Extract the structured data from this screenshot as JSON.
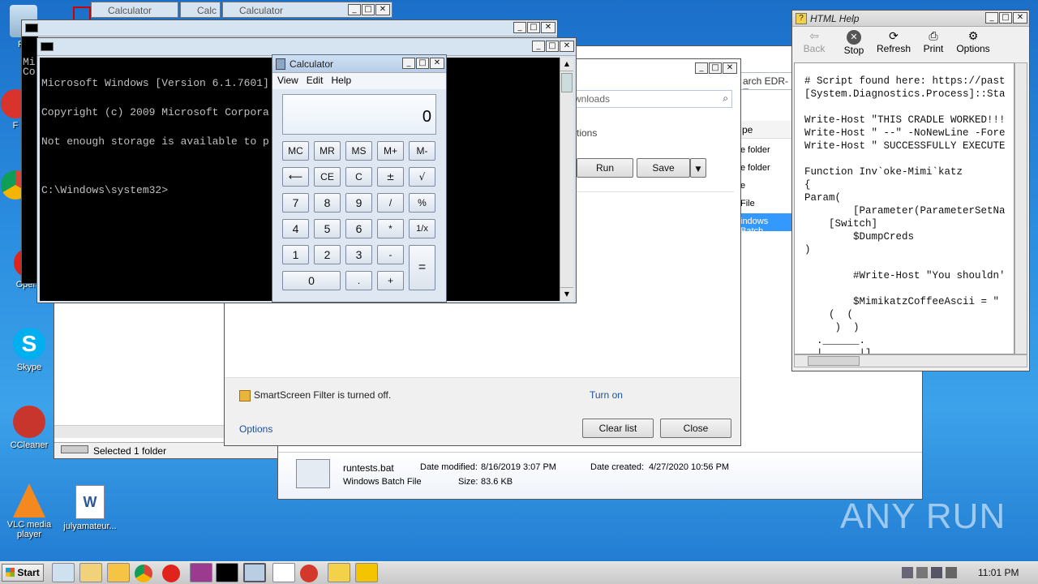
{
  "desktop": {
    "icons": [
      {
        "label": "Re"
      },
      {
        "label": "F"
      },
      {
        "label": "Opera"
      },
      {
        "label": "Skype"
      },
      {
        "label": "CCleaner"
      },
      {
        "label": "VLC media player"
      },
      {
        "label": "julyamateur..."
      }
    ]
  },
  "top_tabs": [
    {
      "label": "Calculator"
    },
    {
      "label": "Calc"
    },
    {
      "label": "Calculator"
    }
  ],
  "cmd": {
    "title_short": "Mi",
    "title_short2": "Co",
    "lines": [
      "Microsoft Windows [Version 6.1.7601]",
      "Copyright (c) 2009 Microsoft Corpora",
      "Not enough storage is available to p",
      "",
      "C:\\Windows\\system32>"
    ]
  },
  "calculator": {
    "title": "Calculator",
    "menu": [
      "View",
      "Edit",
      "Help"
    ],
    "display": "0",
    "buttons": {
      "mc": "MC",
      "mr": "MR",
      "ms": "MS",
      "mplus": "M+",
      "mminus": "M-",
      "back": "⟵",
      "ce": "CE",
      "c": "C",
      "pm": "±",
      "sqrt": "√",
      "n7": "7",
      "n8": "8",
      "n9": "9",
      "div": "/",
      "pct": "%",
      "n4": "4",
      "n5": "5",
      "n6": "6",
      "mul": "*",
      "inv": "1/x",
      "n1": "1",
      "n2": "2",
      "n3": "3",
      "sub": "-",
      "eq": "=",
      "n0": "0",
      "dot": ".",
      "add": "+"
    }
  },
  "downloads": {
    "search_placeholder": "wnloads",
    "section": "ctions",
    "run": "Run",
    "save": "Save",
    "smartscreen": "SmartScreen Filter is turned off.",
    "turn_on": "Turn on",
    "options": "Options",
    "clear_list": "Clear list",
    "close": "Close"
  },
  "explorer": {
    "search_text": "arch EDR-Tes",
    "col_type": "pe",
    "rows": [
      "e folder",
      "e folder",
      "e",
      "File",
      "indows Batch"
    ],
    "status": "Selected 1 folder",
    "details": {
      "filename": "runtests.bat",
      "filetype": "Windows Batch File",
      "modified_label": "Date modified:",
      "modified": "8/16/2019 3:07 PM",
      "created_label": "Date created:",
      "created": "4/27/2020 10:56 PM",
      "size_label": "Size:",
      "size": "83.6 KB"
    }
  },
  "html_help": {
    "title": "HTML Help",
    "toolbar": {
      "back": "Back",
      "stop": "Stop",
      "refresh": "Refresh",
      "print": "Print",
      "options": "Options"
    },
    "lines": [
      "# Script found here: https://past",
      "[System.Diagnostics.Process]::Sta",
      "",
      "Write-Host \"THIS CRADLE WORKED!!!",
      "Write-Host \" --\" -NoNewLine -Fore",
      "Write-Host \" SUCCESSFULLY EXECUTE",
      "",
      "Function Inv`oke-Mimi`katz",
      "{",
      "Param(",
      "        [Parameter(ParameterSetNa",
      "    [Switch]",
      "        $DumpCreds",
      ")",
      "",
      "        #Write-Host \"You shouldn'",
      "",
      "        $MimikatzCoffeeAscii = \"",
      "    (  (",
      "     )  )",
      "  .______.",
      "  |      |]"
    ]
  },
  "taskbar": {
    "start": "Start",
    "clock": "11:01 PM"
  },
  "watermark": "ANY RUN",
  "colors": {
    "accent": "#1f78cf",
    "title_active": "#cde0f5"
  }
}
